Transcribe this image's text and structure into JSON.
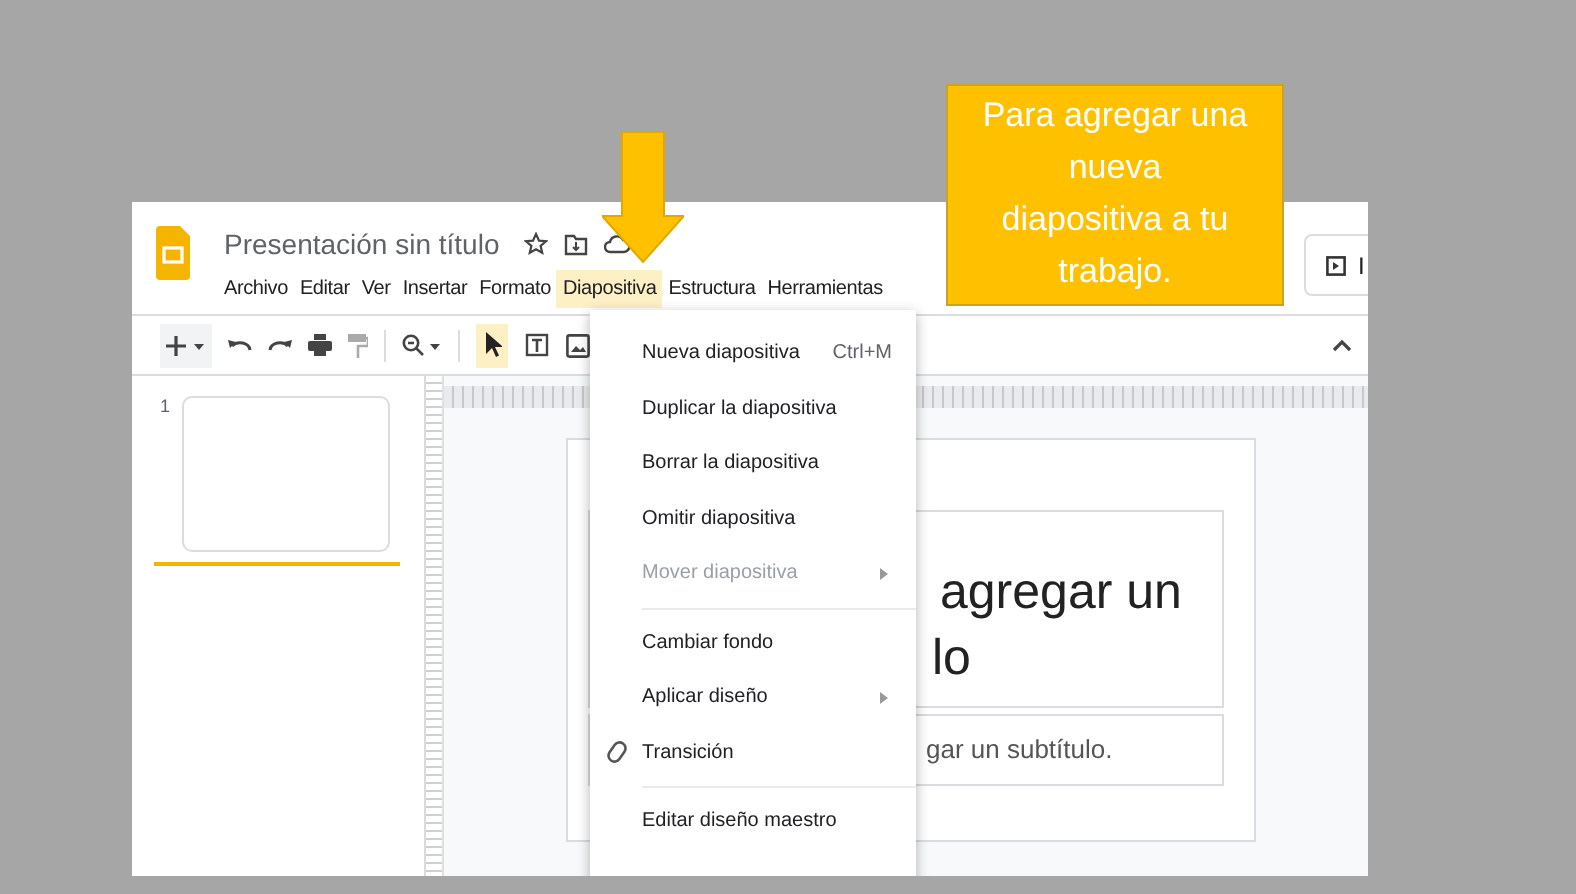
{
  "document": {
    "title": "Presentación sin título"
  },
  "menubar": [
    {
      "label": "Archivo",
      "selected": false
    },
    {
      "label": "Editar",
      "selected": false
    },
    {
      "label": "Ver",
      "selected": false
    },
    {
      "label": "Insertar",
      "selected": false
    },
    {
      "label": "Formato",
      "selected": false
    },
    {
      "label": "Diapositiva",
      "selected": true
    },
    {
      "label": "Estructura",
      "selected": false
    },
    {
      "label": "Herramientas",
      "selected": false
    }
  ],
  "present_button": {
    "label": "I"
  },
  "filmstrip": [
    {
      "number": "1",
      "selected": true
    }
  ],
  "slide": {
    "title_lines": [
      "agregar un",
      "lo"
    ],
    "subtitle": "gar un subtítulo."
  },
  "menu": [
    {
      "kind": "item",
      "label": "Nueva diapositiva",
      "shortcut": "Ctrl+M",
      "disabled": false,
      "submenu": false
    },
    {
      "kind": "item",
      "label": "Duplicar la diapositiva",
      "disabled": false,
      "submenu": false
    },
    {
      "kind": "item",
      "label": "Borrar la diapositiva",
      "disabled": false,
      "submenu": false
    },
    {
      "kind": "item",
      "label": "Omitir diapositiva",
      "disabled": false,
      "submenu": false
    },
    {
      "kind": "item",
      "label": "Mover diapositiva",
      "disabled": true,
      "submenu": true
    },
    {
      "kind": "separator"
    },
    {
      "kind": "item",
      "label": "Cambiar fondo",
      "disabled": false,
      "submenu": false
    },
    {
      "kind": "item",
      "label": "Aplicar diseño",
      "disabled": false,
      "submenu": true
    },
    {
      "kind": "item",
      "label": "Transición",
      "disabled": false,
      "submenu": false,
      "has_icon": true
    },
    {
      "kind": "separator"
    },
    {
      "kind": "item",
      "label": "Editar diseño maestro",
      "disabled": false,
      "submenu": false
    }
  ],
  "callout": {
    "lines": [
      "Para agregar una",
      "nueva",
      "diapositiva a tu",
      "trabajo."
    ]
  }
}
